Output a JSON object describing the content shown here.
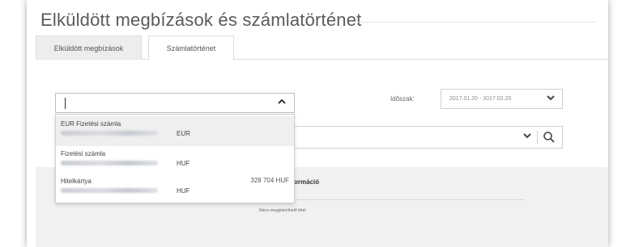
{
  "page": {
    "title": "Elküldött megbízások és számlatörténet"
  },
  "tabs": [
    {
      "label": "Elküldött megbízások"
    },
    {
      "label": "Számlatörténet"
    }
  ],
  "account_select": {
    "value": "",
    "expanded": true,
    "options": [
      {
        "name": "EUR Fizetési számla",
        "currency": "EUR",
        "balance": "",
        "highlighted": true
      },
      {
        "name": "Fizetési számla",
        "currency": "HUF",
        "balance": ""
      },
      {
        "name": "Hitelkártya",
        "currency": "HUF",
        "balance": "328 704 HUF"
      }
    ]
  },
  "period": {
    "label": "Időszak:",
    "value": "2017.01.20 - 2017.02.20"
  },
  "results": {
    "info_header_fragment": "ormáció",
    "empty_message": "Nincs megjeleníthető tétel"
  },
  "icons": {
    "select_toggle": "chevron-up-icon",
    "period_toggle": "chevron-down-icon",
    "filter_toggle": "chevron-down-icon",
    "search": "search-icon"
  },
  "colors": {
    "text": "#4a4a4a",
    "option_highlight": "#efefef",
    "lower_panel": "#f1f1f1"
  }
}
